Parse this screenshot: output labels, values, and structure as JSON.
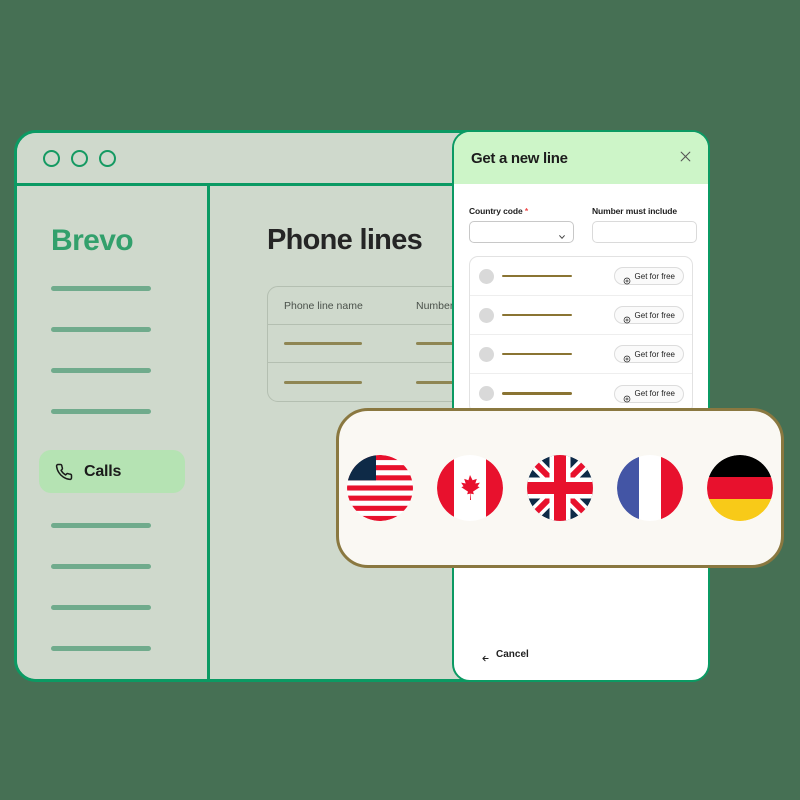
{
  "theme": {
    "page_background": "#467054",
    "window_background": "#cfd9cc",
    "window_border": "#0b9a63",
    "brand_green": "#32a06c",
    "active_item_background": "#b5e3b3",
    "modal_header_background": "#cdf5c8",
    "flag_card_border": "#8a7840",
    "flag_card_background": "#faf8f3",
    "required_asterisk": "#ef4b4b",
    "placeholder_bar_gold": "#8a7433"
  },
  "app_window": {
    "titlebar": {
      "dots": [
        "window-dot-1",
        "window-dot-2",
        "window-dot-3"
      ]
    },
    "sidebar": {
      "logo": "Brevo",
      "placeholder_items_top": [
        "",
        "",
        "",
        ""
      ],
      "active_item": {
        "label": "Calls",
        "icon": "phone-icon"
      },
      "placeholder_items_bottom": [
        "",
        "",
        "",
        ""
      ]
    },
    "main": {
      "page_title": "Phone lines",
      "table": {
        "columns": [
          "Phone line name",
          "Number"
        ],
        "rows": [
          {
            "name": "",
            "number": ""
          },
          {
            "name": "",
            "number": ""
          }
        ]
      }
    }
  },
  "modal": {
    "title": "Get a new line",
    "close_icon": "close-icon",
    "fields": {
      "country_code": {
        "label": "Country code",
        "required_marker": "*",
        "value": "",
        "placeholder": "",
        "chevron_icon": "chevron-down-icon"
      },
      "number_must_include": {
        "label": "Number must include",
        "value": "",
        "placeholder": ""
      }
    },
    "line_results": [
      {
        "number": "",
        "action_label": "Get for free",
        "action_icon": "plus-circle-icon"
      },
      {
        "number": "",
        "action_label": "Get for free",
        "action_icon": "plus-circle-icon"
      },
      {
        "number": "",
        "action_label": "Get for free",
        "action_icon": "plus-circle-icon"
      },
      {
        "number": "",
        "action_label": "Get for free",
        "action_icon": "plus-circle-icon"
      }
    ],
    "footer": {
      "cancel_label": "Cancel",
      "back_icon": "arrow-left-icon"
    }
  },
  "flag_card": {
    "flags": [
      {
        "name": "flag-united-states",
        "country": "United States"
      },
      {
        "name": "flag-canada",
        "country": "Canada"
      },
      {
        "name": "flag-united-kingdom",
        "country": "United Kingdom"
      },
      {
        "name": "flag-france",
        "country": "France"
      },
      {
        "name": "flag-germany",
        "country": "Germany"
      }
    ]
  }
}
